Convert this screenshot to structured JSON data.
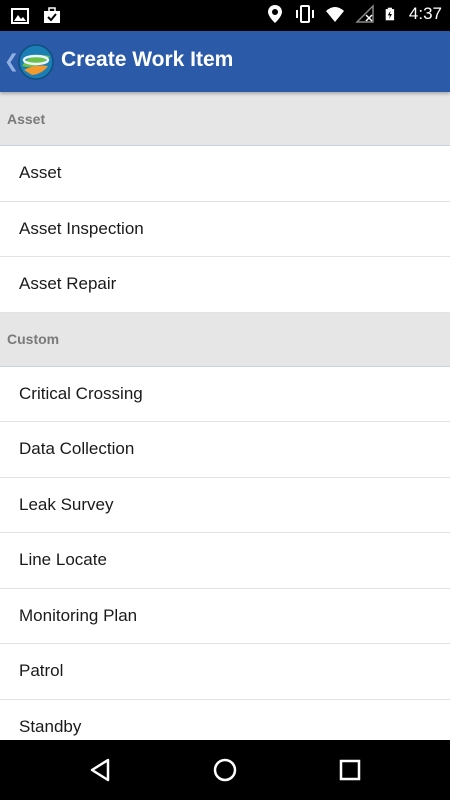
{
  "status_bar": {
    "time": "4:37",
    "left_icons": [
      "image-icon",
      "briefcase-check-icon"
    ],
    "right_icons": [
      "location-pin-icon",
      "vibrate-icon",
      "wifi-icon",
      "signal-off-icon",
      "battery-charging-icon"
    ]
  },
  "action_bar": {
    "title": "Create Work Item",
    "color": "#2a5aa8",
    "back_icon": "chevron-left-icon",
    "logo_icon": "app-globe-icon"
  },
  "sections": [
    {
      "header": "Asset",
      "items": [
        "Asset",
        "Asset Inspection",
        "Asset Repair"
      ]
    },
    {
      "header": "Custom",
      "items": [
        "Critical Crossing",
        "Data Collection",
        "Leak Survey",
        "Line Locate",
        "Monitoring Plan",
        "Patrol",
        "Standby"
      ]
    }
  ],
  "nav_bar": {
    "buttons": [
      "back-icon",
      "home-icon",
      "recents-icon"
    ]
  }
}
